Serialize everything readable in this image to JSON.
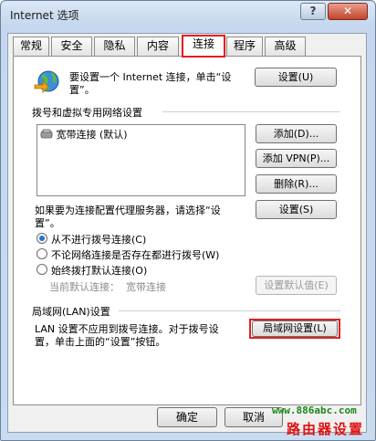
{
  "window": {
    "title": "Internet 选项",
    "help": "?",
    "close": "✕"
  },
  "tabs": [
    {
      "label": "常规"
    },
    {
      "label": "安全"
    },
    {
      "label": "隐私"
    },
    {
      "label": "内容"
    },
    {
      "label": "连接",
      "active": true
    },
    {
      "label": "程序"
    },
    {
      "label": "高级"
    }
  ],
  "setup": {
    "text_line1": "要设置一个 Internet 连接，单击“设",
    "text_line2": "置”。",
    "button": "设置(U)"
  },
  "dialup": {
    "heading": "拨号和虚拟专用网络设置",
    "items": [
      {
        "label": "宽带连接 (默认)"
      }
    ],
    "add_button": "添加(D)...",
    "add_vpn_button": "添加 VPN(P)...",
    "delete_button": "删除(R)...",
    "proxy_text_line1": "如果要为连接配置代理服务器，请选择“设",
    "proxy_text_line2": "置”。",
    "settings_button": "设置(S)",
    "options": [
      {
        "label": "从不进行拨号连接(C)",
        "checked": true
      },
      {
        "label": "不论网络连接是否存在都进行拨号(W)",
        "checked": false
      },
      {
        "label": "始终拨打默认连接(O)",
        "checked": false
      }
    ],
    "current_default_label": "当前默认连接：",
    "current_default_value": "宽带连接",
    "set_default_button": "设置默认值(E)"
  },
  "lan": {
    "heading": "局域网(LAN)设置",
    "text_line1": "LAN 设置不应用到拨号连接。对于拨号设",
    "text_line2": "置，单击上面的“设置”按钮。",
    "button": "局域网设置(L)"
  },
  "footer": {
    "ok": "确定",
    "cancel": "取消"
  },
  "watermark": {
    "url": "www.886abc.com",
    "name": "路由器设置"
  },
  "colors": {
    "highlight": "#e02020",
    "watermark_url": "#1a8a1a",
    "watermark_name": "#e01010"
  }
}
